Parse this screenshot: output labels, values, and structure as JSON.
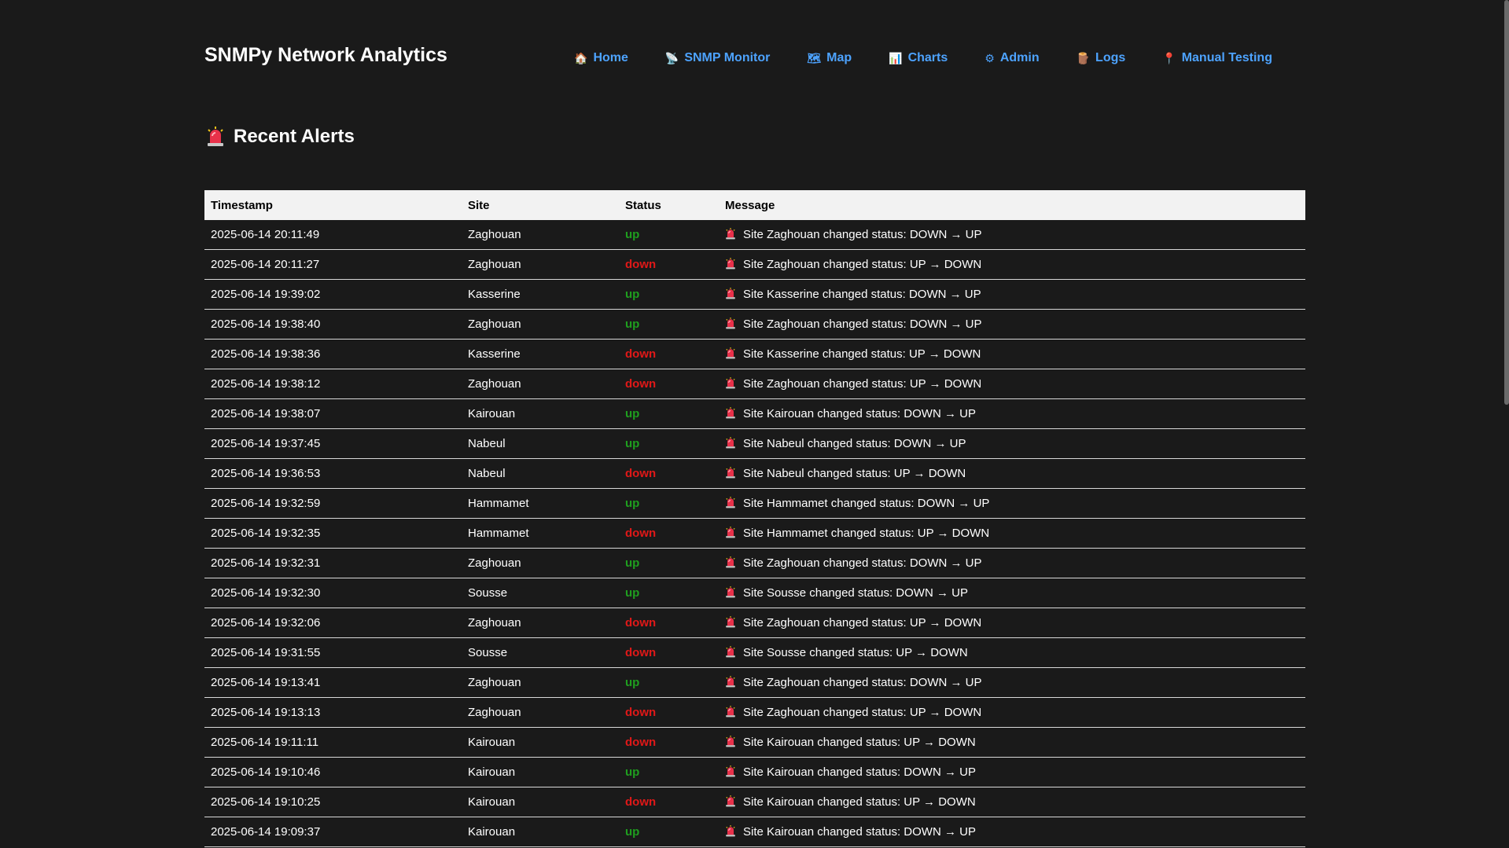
{
  "header": {
    "brand": "SNMPy Network Analytics",
    "nav": [
      {
        "label": "Home",
        "icon": "home-icon",
        "glyph": "🏠"
      },
      {
        "label": "SNMP Monitor",
        "icon": "satellite-icon",
        "glyph": "📡"
      },
      {
        "label": "Map",
        "icon": "map-icon",
        "glyph": "🗺"
      },
      {
        "label": "Charts",
        "icon": "bar-chart-icon",
        "glyph": "📊"
      },
      {
        "label": "Admin",
        "icon": "gear-icon",
        "glyph": "⚙"
      },
      {
        "label": "Logs",
        "icon": "log-icon",
        "glyph": "🪵"
      },
      {
        "label": "Manual Testing",
        "icon": "pin-icon",
        "glyph": "📍"
      }
    ]
  },
  "section": {
    "title": "Recent Alerts",
    "icon": "siren-icon"
  },
  "table": {
    "columns": [
      "Timestamp",
      "Site",
      "Status",
      "Message"
    ],
    "rows": [
      {
        "timestamp": "2025-06-14 20:11:49",
        "site": "Zaghouan",
        "status": "up",
        "message": "Site Zaghouan changed status: DOWN → UP"
      },
      {
        "timestamp": "2025-06-14 20:11:27",
        "site": "Zaghouan",
        "status": "down",
        "message": "Site Zaghouan changed status: UP → DOWN"
      },
      {
        "timestamp": "2025-06-14 19:39:02",
        "site": "Kasserine",
        "status": "up",
        "message": "Site Kasserine changed status: DOWN → UP"
      },
      {
        "timestamp": "2025-06-14 19:38:40",
        "site": "Zaghouan",
        "status": "up",
        "message": "Site Zaghouan changed status: DOWN → UP"
      },
      {
        "timestamp": "2025-06-14 19:38:36",
        "site": "Kasserine",
        "status": "down",
        "message": "Site Kasserine changed status: UP → DOWN"
      },
      {
        "timestamp": "2025-06-14 19:38:12",
        "site": "Zaghouan",
        "status": "down",
        "message": "Site Zaghouan changed status: UP → DOWN"
      },
      {
        "timestamp": "2025-06-14 19:38:07",
        "site": "Kairouan",
        "status": "up",
        "message": "Site Kairouan changed status: DOWN → UP"
      },
      {
        "timestamp": "2025-06-14 19:37:45",
        "site": "Nabeul",
        "status": "up",
        "message": "Site Nabeul changed status: DOWN → UP"
      },
      {
        "timestamp": "2025-06-14 19:36:53",
        "site": "Nabeul",
        "status": "down",
        "message": "Site Nabeul changed status: UP → DOWN"
      },
      {
        "timestamp": "2025-06-14 19:32:59",
        "site": "Hammamet",
        "status": "up",
        "message": "Site Hammamet changed status: DOWN → UP"
      },
      {
        "timestamp": "2025-06-14 19:32:35",
        "site": "Hammamet",
        "status": "down",
        "message": "Site Hammamet changed status: UP → DOWN"
      },
      {
        "timestamp": "2025-06-14 19:32:31",
        "site": "Zaghouan",
        "status": "up",
        "message": "Site Zaghouan changed status: DOWN → UP"
      },
      {
        "timestamp": "2025-06-14 19:32:30",
        "site": "Sousse",
        "status": "up",
        "message": "Site Sousse changed status: DOWN → UP"
      },
      {
        "timestamp": "2025-06-14 19:32:06",
        "site": "Zaghouan",
        "status": "down",
        "message": "Site Zaghouan changed status: UP → DOWN"
      },
      {
        "timestamp": "2025-06-14 19:31:55",
        "site": "Sousse",
        "status": "down",
        "message": "Site Sousse changed status: UP → DOWN"
      },
      {
        "timestamp": "2025-06-14 19:13:41",
        "site": "Zaghouan",
        "status": "up",
        "message": "Site Zaghouan changed status: DOWN → UP"
      },
      {
        "timestamp": "2025-06-14 19:13:13",
        "site": "Zaghouan",
        "status": "down",
        "message": "Site Zaghouan changed status: UP → DOWN"
      },
      {
        "timestamp": "2025-06-14 19:11:11",
        "site": "Kairouan",
        "status": "down",
        "message": "Site Kairouan changed status: UP → DOWN"
      },
      {
        "timestamp": "2025-06-14 19:10:46",
        "site": "Kairouan",
        "status": "up",
        "message": "Site Kairouan changed status: DOWN → UP"
      },
      {
        "timestamp": "2025-06-14 19:10:25",
        "site": "Kairouan",
        "status": "down",
        "message": "Site Kairouan changed status: UP → DOWN"
      },
      {
        "timestamp": "2025-06-14 19:09:37",
        "site": "Kairouan",
        "status": "up",
        "message": "Site Kairouan changed status: DOWN → UP"
      }
    ]
  },
  "colors": {
    "background": "#1a1a1a",
    "link": "#4da3ff",
    "status_up": "#1f9e1f",
    "status_down": "#e01818",
    "header_row": "#f2f2f2"
  }
}
